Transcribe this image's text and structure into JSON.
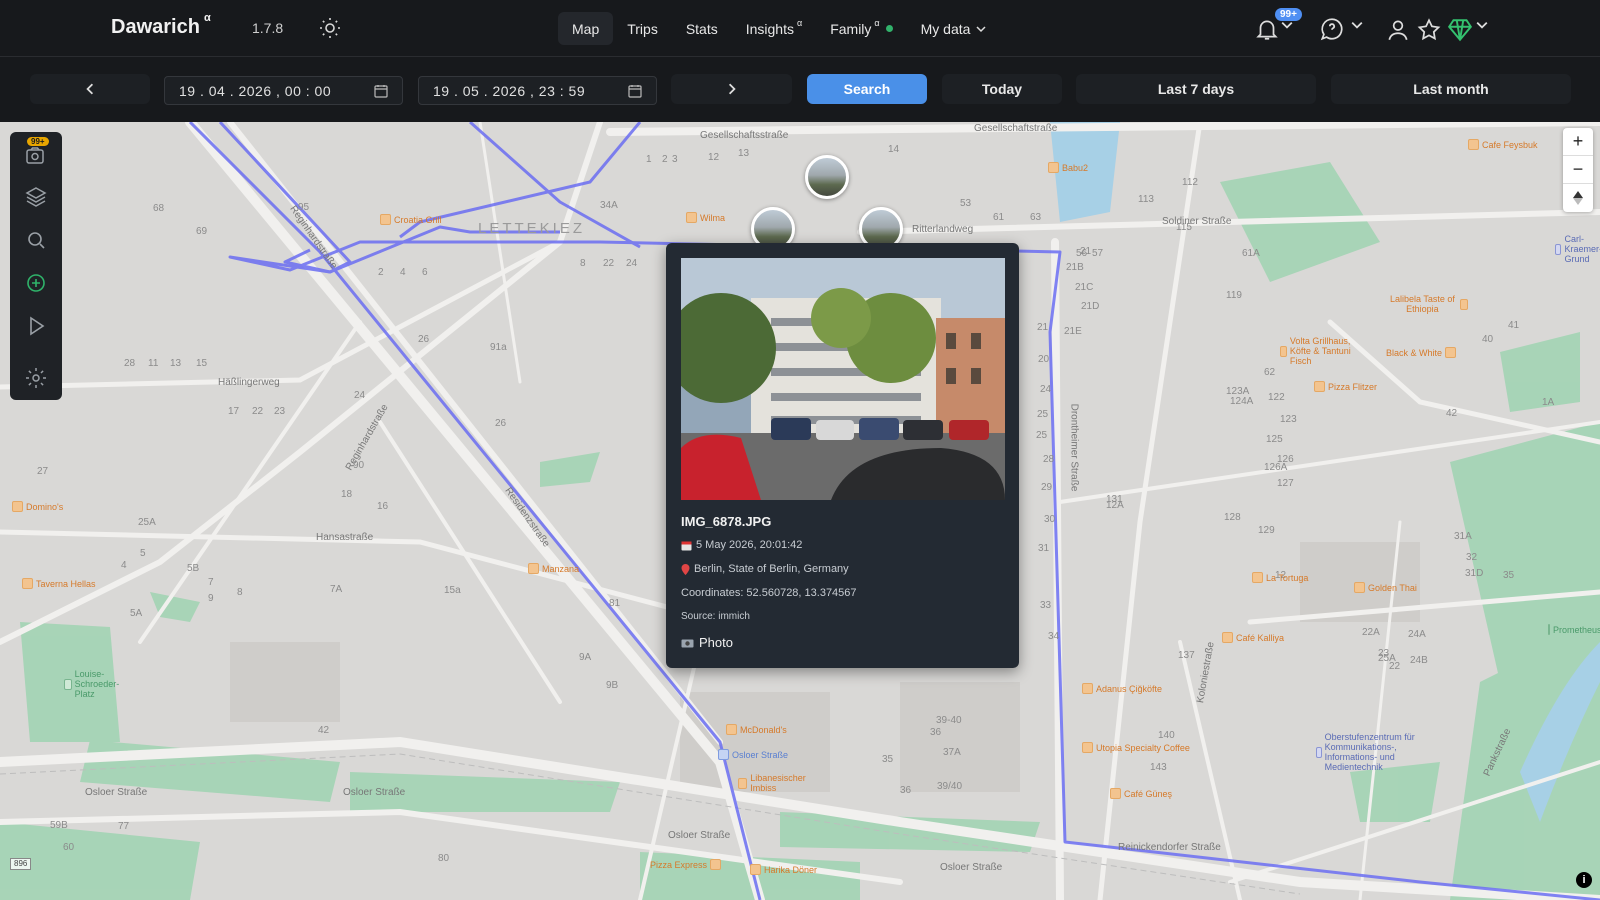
{
  "app": {
    "name": "Dawarich",
    "alpha": "α",
    "version": "1.7.8"
  },
  "nav": {
    "map": "Map",
    "trips": "Trips",
    "stats": "Stats",
    "insights": "Insights",
    "insights_alpha": "α",
    "family": "Family",
    "family_alpha": "α",
    "my_data": "My data"
  },
  "notifications": {
    "badge": "99+"
  },
  "datebar": {
    "start": "19 . 04 . 2026 ,  00 : 00",
    "end": "19 . 05 . 2026 ,  23 : 59",
    "search": "Search",
    "today": "Today",
    "last7": "Last 7 days",
    "last_month": "Last month"
  },
  "toolbar": {
    "badge": "99+"
  },
  "map": {
    "district": "LETTEKIEZ",
    "streets": [
      "Gesellschaftsstraße",
      "Gesellschaftstraße",
      "Soldiner Straße",
      "Ritterlandweg",
      "Häßlingerweg",
      "Hansastraße",
      "Osloer Straße",
      "Osloer Straße",
      "Osloer Straße",
      "Osloer Straße",
      "Reinickendorfer Straße",
      "Reginhardstraße",
      "Residenzstraße",
      "Drontheimer Straße",
      "Koloniestraße",
      "Pankstraße",
      "Reginhardstraße"
    ],
    "house_numbers": [
      "1",
      "2",
      "3",
      "12",
      "13",
      "14",
      "34A",
      "53",
      "61",
      "63",
      "68",
      "69",
      "95",
      "2",
      "4",
      "6",
      "8",
      "22",
      "24",
      "26",
      "91a",
      "28",
      "11",
      "13",
      "15",
      "17",
      "22",
      "23",
      "24",
      "26",
      "27",
      "90",
      "25A",
      "18",
      "16",
      "7A",
      "5",
      "5B",
      "4",
      "8",
      "9",
      "5A",
      "7",
      "15a",
      "81",
      "9A",
      "9B",
      "42",
      "39-40",
      "37A",
      "39/40",
      "36",
      "35",
      "36",
      "60",
      "59B",
      "77",
      "80",
      "21",
      "21B",
      "21C",
      "21D",
      "21E",
      "21",
      "20",
      "24",
      "25",
      "25",
      "28",
      "29",
      "30",
      "31",
      "33",
      "34",
      "56",
      "57",
      "113",
      "112",
      "115",
      "119",
      "61A",
      "62",
      "123A",
      "124A",
      "122",
      "123",
      "125",
      "126",
      "126A",
      "127",
      "128",
      "129",
      "131",
      "12A",
      "12",
      "137",
      "140",
      "143",
      "24A",
      "24B",
      "25A",
      "22A",
      "22",
      "23",
      "31A",
      "31D",
      "32",
      "35",
      "39",
      "40",
      "41",
      "42",
      "1A"
    ],
    "pois": [
      "Croatia Grill",
      "Wilma",
      "Babu2",
      "Cafe Feysbuk",
      "Lalibela Taste of Ethiopia",
      "Volta Grillhaus, Köfte & Tantuni Fisch",
      "Black & White",
      "Pizza Flitzer",
      "Domino's",
      "Taverna Hellas",
      "Manzana",
      "La Tortuga",
      "Golden Thai",
      "Café Kalliya",
      "Adanus Çiğköfte",
      "McDonald's",
      "Osloer Straße",
      "Libanesischer Imbiss",
      "Utopia Specialty Coffee",
      "Café Güneş",
      "Pizza Express",
      "Harika Döner",
      "Louise-Schroeder-Platz",
      "Oberstufenzentrum für Kommunikations-, Informations- und Medientechnik",
      "Carl-Kraemer-Grund",
      "Prometheus"
    ]
  },
  "popup": {
    "title": "IMG_6878.JPG",
    "date": "5 May 2026, 20:01:42",
    "location": "Berlin, State of Berlin, Germany",
    "coordinates": "Coordinates: 52.560728, 13.374567",
    "source": "Source: immich",
    "photo_link": "Photo",
    "close": "×"
  },
  "scale": "896",
  "colors": {
    "accent": "#4a90e8",
    "route": "#6b6ef2",
    "park": "#8fcfa8",
    "badge": "#e8a600"
  }
}
